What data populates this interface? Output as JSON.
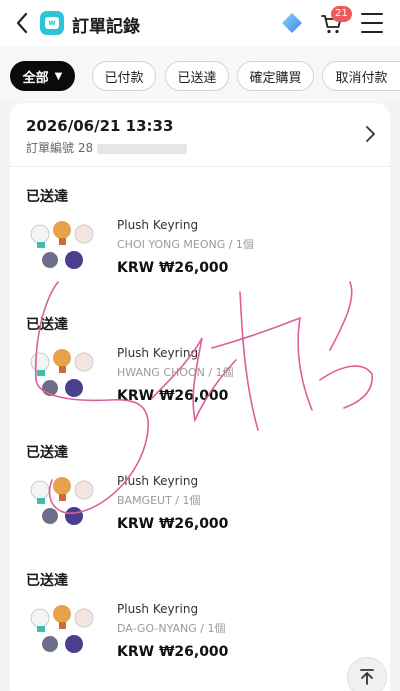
{
  "header": {
    "title": "訂單記錄",
    "cart_count": "21",
    "icons": [
      "chevron-left-icon",
      "app-logo-icon",
      "diamond-icon",
      "cart-icon",
      "menu-icon"
    ]
  },
  "filters": [
    "全部",
    "已付款",
    "已送達",
    "確定購買",
    "取消付款"
  ],
  "order": {
    "date": "2026/06/21 13:33",
    "number_prefix": "訂單編號 28"
  },
  "items": [
    {
      "status": "已送達",
      "name": "Plush Keyring",
      "option": "CHOI YONG MEONG / 1個",
      "price": "KRW ₩26,000"
    },
    {
      "status": "已送達",
      "name": "Plush Keyring",
      "option": "HWANG CHOON / 1個",
      "price": "KRW ₩26,000"
    },
    {
      "status": "已送達",
      "name": "Plush Keyring",
      "option": "BAMGEUT / 1個",
      "price": "KRW ₩26,000"
    },
    {
      "status": "已送達",
      "name": "Plush Keyring",
      "option": "DA-GO-NYANG / 1個",
      "price": "KRW ₩26,000"
    }
  ],
  "colors": {
    "accent": "#2ec3d9",
    "badge": "#f05a5a",
    "scribble": "#e05d9b"
  }
}
